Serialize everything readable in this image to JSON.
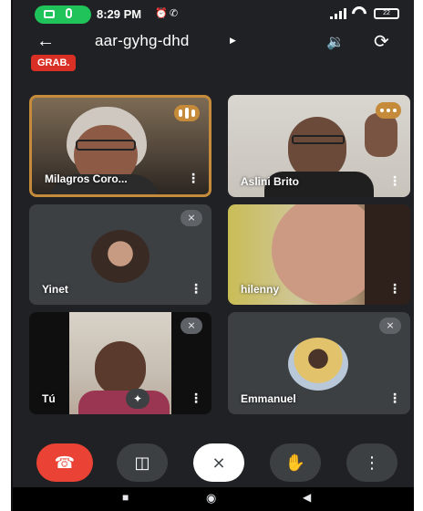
{
  "status": {
    "time": "8:29 PM",
    "battery": "22"
  },
  "header": {
    "meeting_code": "aar-gyhg-dhd",
    "record_badge": "GRAB."
  },
  "participants": [
    {
      "name": "Milagros Coro...",
      "speaking": true
    },
    {
      "name": "Aslini Brito",
      "speaking": true
    },
    {
      "name": "Yinet",
      "muted": true
    },
    {
      "name": "hilenny"
    },
    {
      "name": "Tú",
      "muted": true
    },
    {
      "name": "Emmanuel",
      "muted": true
    }
  ],
  "controls": [
    "end-call",
    "camera",
    "microphone-off",
    "raise-hand",
    "more-options"
  ],
  "colors": {
    "background": "#202124",
    "tile": "#3c4043",
    "end_call": "#ea4335",
    "speaking_border": "#c58a3a",
    "record": "#d93025"
  }
}
